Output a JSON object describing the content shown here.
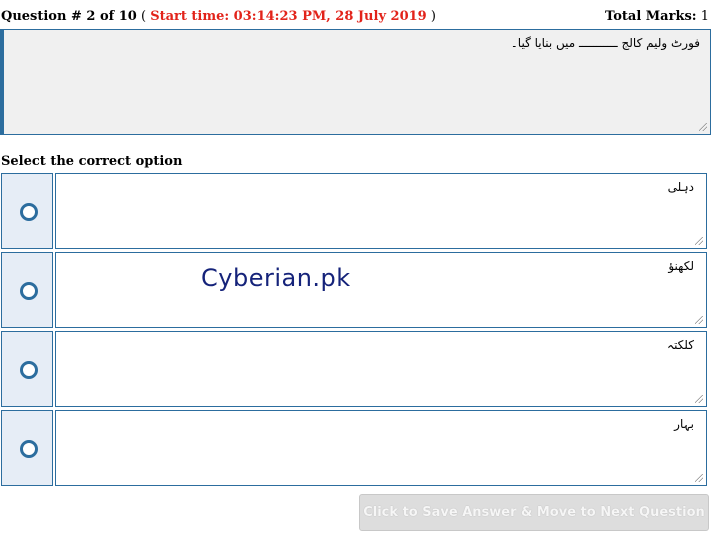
{
  "header": {
    "question_label": "Question # 2 of 10",
    "open_paren": "(",
    "start_time": "Start time: 03:14:23 PM, 28 July 2019",
    "close_paren": ")",
    "total_marks_label": "Total Marks:",
    "total_marks_value": "1"
  },
  "question": {
    "text": "فورٹ ولیم کالج ـــــــــــ میں بنایا گیا۔"
  },
  "instruction": "Select the correct option",
  "options": [
    {
      "text": "دہلی"
    },
    {
      "text": "لکھنؤ"
    },
    {
      "text": "کلکتہ"
    },
    {
      "text": "بہار"
    }
  ],
  "watermark": "Cyberian.pk",
  "next_button": "Click to Save Answer & Move to Next Question",
  "colors": {
    "accent": "#2c6d9e",
    "time_red": "#e2231a",
    "radio_cell_bg": "#e6edf6",
    "question_bg": "#f0f0f0",
    "watermark": "#15237a",
    "button_disabled_bg": "#dddddd"
  }
}
